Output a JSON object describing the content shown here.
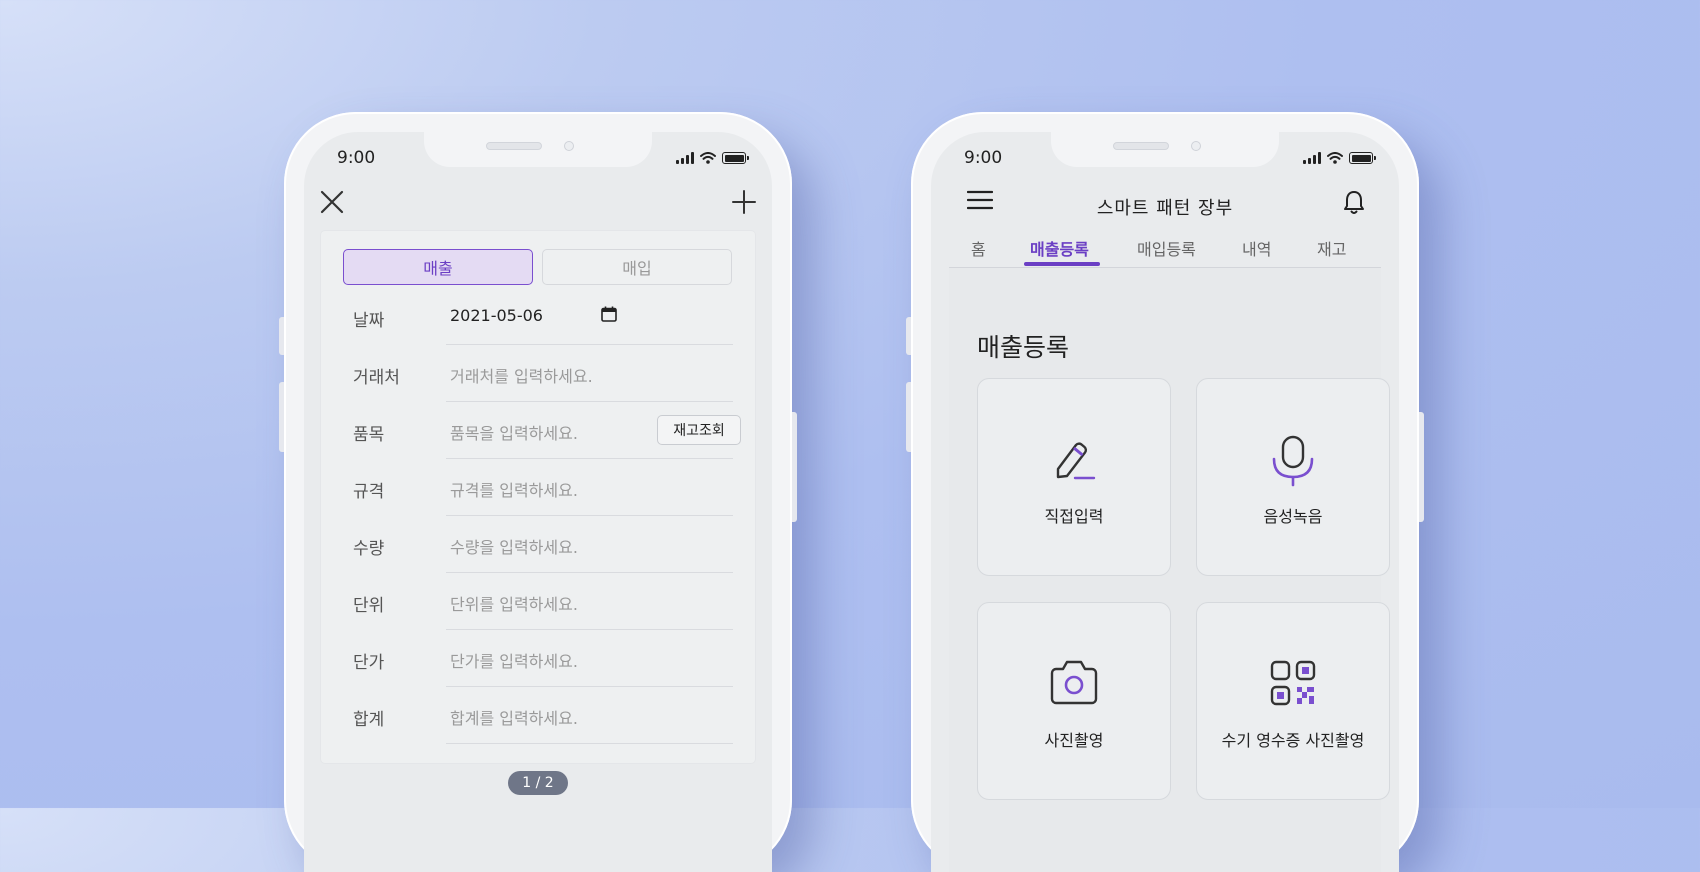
{
  "colors": {
    "accent": "#6b3fc4",
    "accent_light": "#e4dbf3"
  },
  "status_bar": {
    "time": "9:00"
  },
  "left_phone": {
    "close_icon": "close-icon",
    "add_icon": "plus-icon",
    "segment": {
      "sales": "매출",
      "purchase": "매입"
    },
    "fields": [
      {
        "label": "날짜",
        "value": "2021-05-06",
        "placeholder": ""
      },
      {
        "label": "거래처",
        "value": "",
        "placeholder": "거래처를 입력하세요."
      },
      {
        "label": "품목",
        "value": "",
        "placeholder": "품목을 입력하세요."
      },
      {
        "label": "규격",
        "value": "",
        "placeholder": "규격를 입력하세요."
      },
      {
        "label": "수량",
        "value": "",
        "placeholder": "수량을 입력하세요."
      },
      {
        "label": "단위",
        "value": "",
        "placeholder": "단위를 입력하세요."
      },
      {
        "label": "단가",
        "value": "",
        "placeholder": "단가를 입력하세요."
      },
      {
        "label": "합계",
        "value": "",
        "placeholder": "합계를 입력하세요."
      }
    ],
    "stock_button": "재고조회",
    "pager": "1 / 2"
  },
  "right_phone": {
    "title": "스마트 패턴 장부",
    "tabs": [
      "홈",
      "매출등록",
      "매입등록",
      "내역",
      "재고"
    ],
    "active_tab": "매출등록",
    "section_title": "매출등록",
    "tiles": [
      {
        "label": "직접입력",
        "icon": "pencil-icon"
      },
      {
        "label": "음성녹음",
        "icon": "microphone-icon"
      },
      {
        "label": "사진촬영",
        "icon": "camera-icon"
      },
      {
        "label": "수기 영수증 사진촬영",
        "icon": "qr-code-icon"
      }
    ]
  }
}
